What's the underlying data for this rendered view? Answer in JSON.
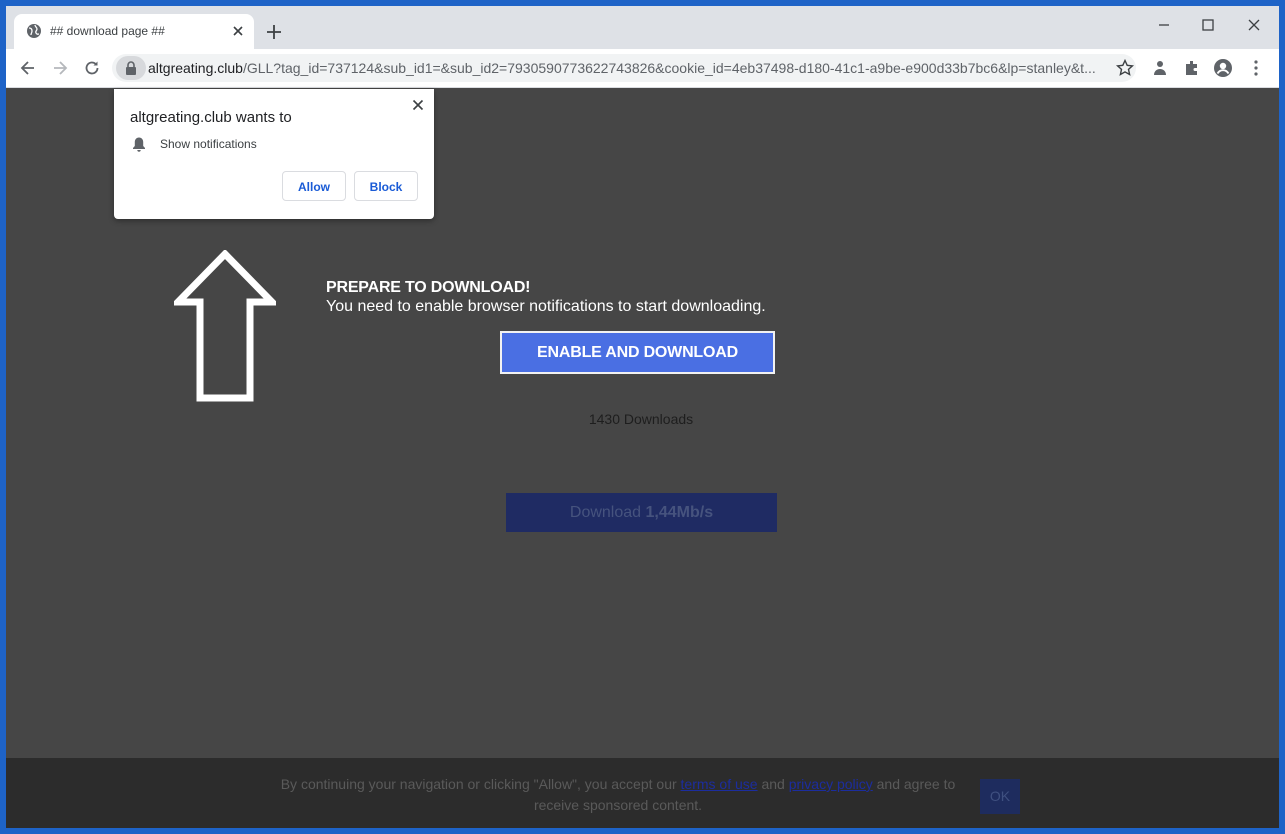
{
  "browser": {
    "tab_title": "## download page ##",
    "url_host": "altgreating.club",
    "url_path": "/GLL?tag_id=737124&sub_id1=&sub_id2=7930590773622743826&cookie_id=4eb37498-d180-41c1-a9be-e900d33b7bc6&lp=stanley&t..."
  },
  "popup": {
    "title": "altgreating.club wants to",
    "permission": "Show notifications",
    "allow_label": "Allow",
    "block_label": "Block"
  },
  "page": {
    "heading": "PREPARE TO DOWNLOAD!",
    "subtext": "You need to enable browser notifications to start downloading.",
    "enable_button": "ENABLE AND DOWNLOAD",
    "downloads_count": "1430 Downloads",
    "download_button_prefix": "Download ",
    "download_speed": "1,44Mb/s"
  },
  "consent": {
    "text_before": "By continuing your navigation or clicking \"Allow\", you accept our ",
    "terms_link": "terms of use",
    "and_word": " and ",
    "privacy_link": "privacy policy",
    "text_after": " and agree to receive sponsored content.",
    "ok_label": "OK"
  },
  "colors": {
    "page_background": "#464646",
    "enable_button": "#4a6fe3",
    "popup_button_text": "#1a5bd6"
  }
}
